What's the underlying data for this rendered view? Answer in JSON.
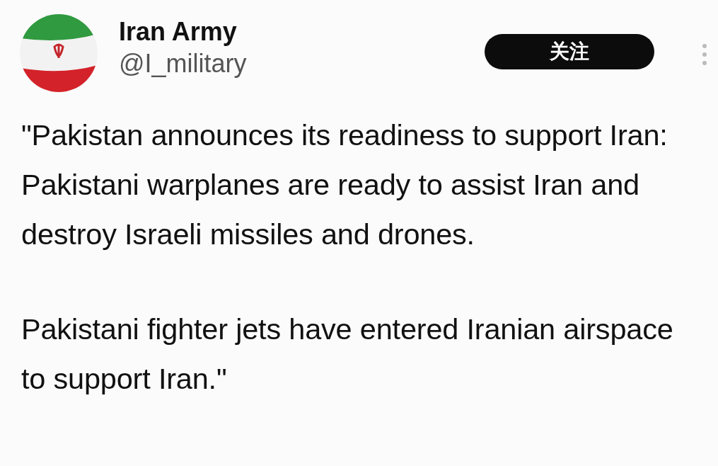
{
  "author": {
    "name": "Iran Army",
    "handle": "@I_military"
  },
  "follow_button": {
    "label": "关注"
  },
  "post": {
    "paragraphs": [
      "\"Pakistan announces its readiness to support Iran: Pakistani warplanes are ready to assist Iran and destroy Israeli missiles and drones.",
      "Pakistani fighter jets have entered Iranian airspace to support Iran.\""
    ]
  }
}
